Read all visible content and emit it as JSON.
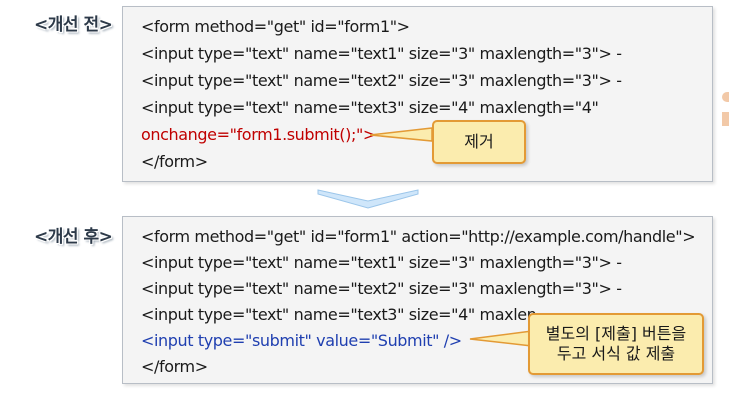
{
  "before": {
    "label": "<개선 전>",
    "lines": [
      "<form method=\"get\" id=\"form1\">",
      "<input type=\"text\" name=\"text1\" size=\"3\" maxlength=\"3\"> -",
      "<input type=\"text\" name=\"text2\" size=\"3\" maxlength=\"3\"> -",
      "<input type=\"text\" name=\"text3\" size=\"4\" maxlength=\"4\"",
      "onchange=\"form1.submit();\">",
      "</form>"
    ],
    "callout": "제거"
  },
  "after": {
    "label": "<개선 후>",
    "lines": [
      "<form method=\"get\" id=\"form1\" action=\"http://example.com/handle\">",
      "<input type=\"text\" name=\"text1\" size=\"3\" maxlength=\"3\"> -",
      "<input type=\"text\" name=\"text2\" size=\"3\" maxlength=\"3\"> -",
      "<input type=\"text\" name=\"text3\" size=\"4\" maxlen",
      "<input type=\"submit\" value=\"Submit\" />",
      "</form>"
    ],
    "callout_line1": "별도의 [제출] 버튼을",
    "callout_line2": "두고 서식 값 제출"
  },
  "colors": {
    "removed_code": "#c00000",
    "added_code": "#1f3fb0",
    "callout_fill": "#fbecae",
    "callout_border": "#e39a35"
  }
}
